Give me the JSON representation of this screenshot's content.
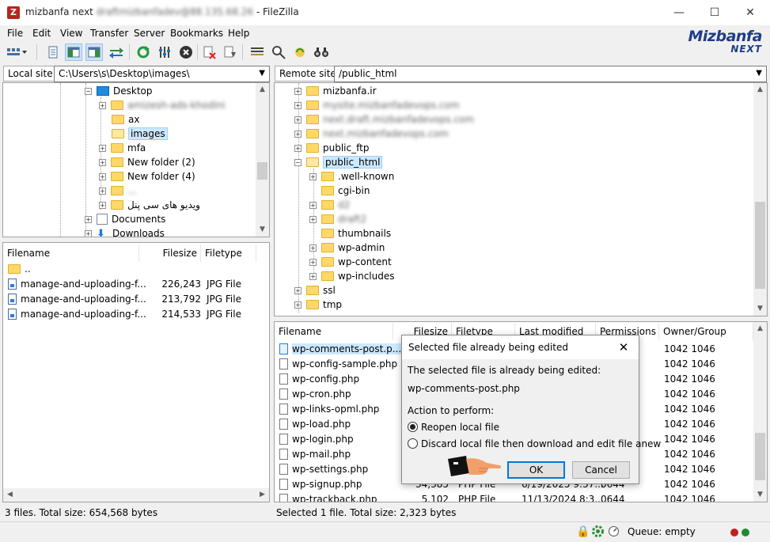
{
  "window": {
    "title_visible": "mizbanfa next",
    "title_blurred": "draftmizbanfadev@88.135.68.26",
    "title_suffix": " - FileZilla",
    "minimize": "—",
    "maximize": "☐",
    "close": "✕"
  },
  "menu": [
    "File",
    "Edit",
    "View",
    "Transfer",
    "Server",
    "Bookmarks",
    "Help"
  ],
  "logo": {
    "line1": "Mizbanfa",
    "line2": "NEXT"
  },
  "local": {
    "site_label": "Local site:",
    "path": "C:\\Users\\s\\Desktop\\images\\",
    "tree": [
      {
        "label": "Desktop"
      },
      {
        "label": "amizesh-ads-khodini"
      },
      {
        "label": "ax"
      },
      {
        "label": "images"
      },
      {
        "label": "mfa"
      },
      {
        "label": "New folder (2)"
      },
      {
        "label": "New folder (4)"
      },
      {
        "label": "..."
      },
      {
        "label": "ویدیو های سی پنل"
      },
      {
        "label": "Documents"
      },
      {
        "label": "Downloads"
      }
    ],
    "columns": [
      "Filename",
      "Filesize",
      "Filetype"
    ],
    "files": [
      {
        "name": "..",
        "size": "",
        "type": ""
      },
      {
        "name": "manage-and-uploading-f...",
        "size": "226,243",
        "type": "JPG File"
      },
      {
        "name": "manage-and-uploading-f...",
        "size": "213,792",
        "type": "JPG File"
      },
      {
        "name": "manage-and-uploading-f...",
        "size": "214,533",
        "type": "JPG File"
      }
    ],
    "status": "3 files. Total size: 654,568 bytes"
  },
  "remote": {
    "site_label": "Remote site:",
    "path": "/public_html",
    "tree": [
      {
        "label": "mizbanfa.ir"
      },
      {
        "label": "mysite.mizbanfadevops.com"
      },
      {
        "label": "next.draft.mizbanfadevops.com"
      },
      {
        "label": "next.mizbanfadevops.com"
      },
      {
        "label": "public_ftp"
      },
      {
        "label": "public_html"
      },
      {
        "label": ".well-known"
      },
      {
        "label": "cgi-bin"
      },
      {
        "label": "d2"
      },
      {
        "label": "draft2"
      },
      {
        "label": "thumbnails"
      },
      {
        "label": "wp-admin"
      },
      {
        "label": "wp-content"
      },
      {
        "label": "wp-includes"
      },
      {
        "label": "ssl"
      },
      {
        "label": "tmp"
      }
    ],
    "columns": [
      "Filename",
      "Filesize",
      "Filetype",
      "Last modified",
      "Permissions",
      "Owner/Group"
    ],
    "files": [
      {
        "name": "wp-comments-post.p...",
        "size": "",
        "type": "",
        "modified": "",
        "perms": "",
        "owner": "1042 1046"
      },
      {
        "name": "wp-config-sample.php",
        "size": "",
        "type": "",
        "modified": "",
        "perms": "",
        "owner": "1042 1046"
      },
      {
        "name": "wp-config.php",
        "size": "",
        "type": "",
        "modified": "",
        "perms": "",
        "owner": "1042 1046"
      },
      {
        "name": "wp-cron.php",
        "size": "",
        "type": "",
        "modified": "",
        "perms": "",
        "owner": "1042 1046"
      },
      {
        "name": "wp-links-opml.php",
        "size": "",
        "type": "",
        "modified": "",
        "perms": "",
        "owner": "1042 1046"
      },
      {
        "name": "wp-load.php",
        "size": "",
        "type": "",
        "modified": "",
        "perms": "",
        "owner": "1042 1046"
      },
      {
        "name": "wp-login.php",
        "size": "",
        "type": "",
        "modified": "",
        "perms": "",
        "owner": "1042 1046"
      },
      {
        "name": "wp-mail.php",
        "size": "",
        "type": "",
        "modified": "",
        "perms": "",
        "owner": "1042 1046"
      },
      {
        "name": "wp-settings.php",
        "size": "",
        "type": "",
        "modified": "",
        "perms": "",
        "owner": "1042 1046"
      },
      {
        "name": "wp-signup.php",
        "size": "34,385",
        "type": "PHP File",
        "modified": "6/19/2025 9:37...",
        "perms": "0644",
        "owner": "1042 1046"
      },
      {
        "name": "wp-trackback.php",
        "size": "5,102",
        "type": "PHP File",
        "modified": "11/13/2024 8:3...",
        "perms": "0644",
        "owner": "1042 1046"
      }
    ],
    "status": "Selected 1 file. Total size: 2,323 bytes"
  },
  "dialog": {
    "title": "Selected file already being edited",
    "message": "The selected file is already being edited:",
    "filename": "wp-comments-post.php",
    "action_label": "Action to perform:",
    "options": [
      "Reopen local file",
      "Discard local file then download and edit file anew"
    ],
    "selected_option": 0,
    "ok": "OK",
    "cancel": "Cancel"
  },
  "bottom": {
    "queue": "Queue: empty"
  },
  "colors": {
    "selection": "#cce8ff",
    "folder": "#ffd867",
    "accent": "#0078d7",
    "logo": "#1f3c87"
  }
}
